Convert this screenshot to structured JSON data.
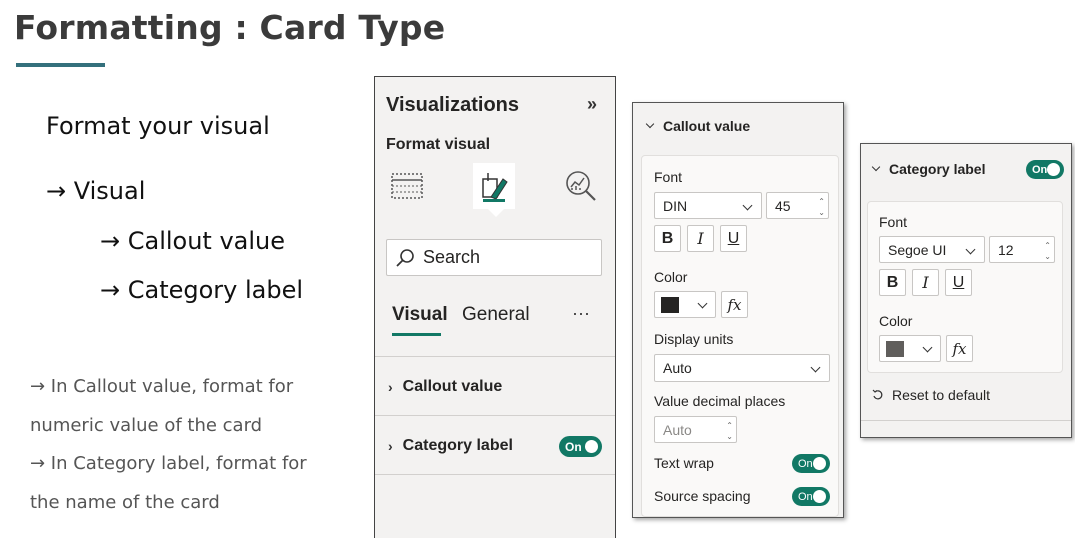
{
  "slide": {
    "title": "Formatting : Card Type",
    "bullets": [
      "Format your visual",
      "→ Visual",
      "→ Callout value",
      "→ Category label"
    ],
    "notes": [
      "→ In Callout value, format for",
      "numeric value of the card",
      "→ In Category label, format for",
      "the name of the card"
    ]
  },
  "viz_pane": {
    "title": "Visualizations",
    "collapse_icon": "»",
    "subtitle": "Format visual",
    "search_placeholder": "Search",
    "tabs": [
      "Visual",
      "General"
    ],
    "more_icon": "···",
    "sections": [
      {
        "label": "Callout value"
      },
      {
        "label": "Category label",
        "toggle": "On"
      }
    ]
  },
  "callout_panel": {
    "header": "Callout value",
    "font_label": "Font",
    "font_family": "DIN",
    "font_size": "45",
    "style_buttons": [
      "B",
      "I",
      "U"
    ],
    "color_label": "Color",
    "color_value": "#252423",
    "fx_label": "fx",
    "display_units_label": "Display units",
    "display_units_value": "Auto",
    "decimal_label": "Value decimal places",
    "decimal_value": "Auto",
    "text_wrap_label": "Text wrap",
    "text_wrap_toggle": "On",
    "source_spacing_label": "Source spacing",
    "source_spacing_toggle": "On"
  },
  "category_panel": {
    "header": "Category label",
    "header_toggle": "On",
    "font_label": "Font",
    "font_family": "Segoe UI",
    "font_size": "12",
    "style_buttons": [
      "B",
      "I",
      "U"
    ],
    "color_label": "Color",
    "color_value": "#605e5c",
    "fx_label": "fx",
    "reset_label": "Reset to default"
  },
  "colors": {
    "accent": "#117865",
    "rule": "#34707c"
  }
}
